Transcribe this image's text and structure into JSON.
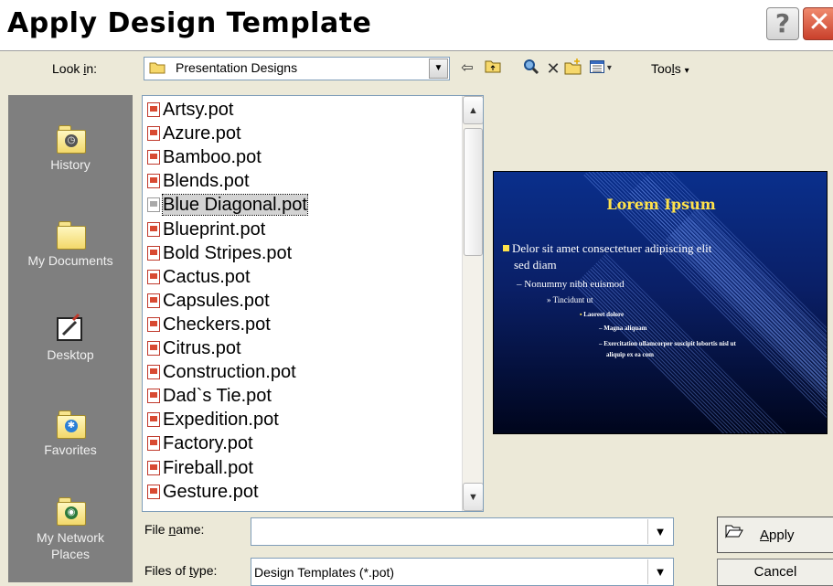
{
  "dialog": {
    "title": "Apply Design Template",
    "help_label": "?",
    "close_label": "✕"
  },
  "lookin": {
    "label": "Look in:",
    "value": "Presentation Designs",
    "toolbar": [
      "back-icon",
      "up-folder-icon",
      "search-web-icon",
      "delete-icon",
      "new-folder-icon",
      "views-icon"
    ],
    "tools_label": "Tools"
  },
  "places": [
    {
      "label": "History",
      "icon": "history-icon"
    },
    {
      "label": "My Documents",
      "icon": "my-documents-icon"
    },
    {
      "label": "Desktop",
      "icon": "desktop-icon"
    },
    {
      "label": "Favorites",
      "icon": "favorites-icon"
    },
    {
      "label": "My Network Places",
      "icon": "network-places-icon"
    }
  ],
  "files": [
    "Artsy.pot",
    "Azure.pot",
    "Bamboo.pot",
    "Blends.pot",
    "Blue Diagonal.pot",
    "Blueprint.pot",
    "Bold Stripes.pot",
    "Cactus.pot",
    "Capsules.pot",
    "Checkers.pot",
    "Citrus.pot",
    "Construction.pot",
    "Dad`s Tie.pot",
    "Expedition.pot",
    "Factory.pot",
    "Fireball.pot",
    "Gesture.pot"
  ],
  "selected_file": "Blue Diagonal.pot",
  "preview": {
    "title": "Lorem Ipsum",
    "bullet1": "Delor sit amet consectetuer adipiscing elit",
    "bullet1_cont": "sed diam",
    "bullet2": "– Nonummy nibh euismod",
    "bullet3": "» Tincidunt ut",
    "bullet4": "Laoreet dolore",
    "bullet5": "– Magna aliquam",
    "bullet6": "– Exercitation ullamcorper suscipit lobortis nisl ut",
    "bullet6_cont": "aliquip ex ea com"
  },
  "filename": {
    "label": "File name:",
    "value": ""
  },
  "filetype": {
    "label": "Files of type:",
    "value": "Design Templates (*.pot)"
  },
  "buttons": {
    "apply": "Apply",
    "cancel": "Cancel"
  },
  "colors": {
    "preview_title": "#ffe24a",
    "preview_bg": "#0a2f8c",
    "places_bg": "#7f7f7f"
  }
}
